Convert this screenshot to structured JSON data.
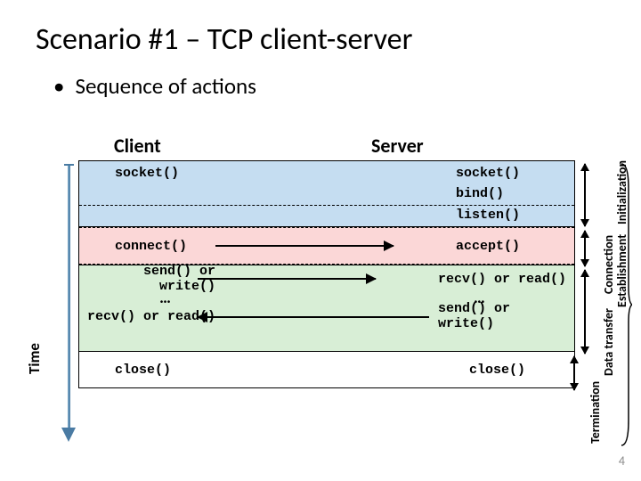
{
  "title": "Scenario #1 – TCP client-server",
  "subtitle_bullet": "•",
  "subtitle": "Sequence of actions",
  "headers": {
    "client": "Client",
    "server": "Server"
  },
  "phases": {
    "init": {
      "client": [
        "socket()"
      ],
      "server": [
        "socket()",
        "bind()",
        "listen()"
      ],
      "label": "Initialization"
    },
    "conn": {
      "client": "connect()",
      "server": "accept()",
      "label1": "Connection",
      "label2": "Establishment"
    },
    "data": {
      "client": [
        "send() or write()",
        "…",
        "recv() or read()"
      ],
      "server": [
        "recv() or read()",
        "…",
        "send() or write()"
      ],
      "label": "Data transfer"
    },
    "term": {
      "client": "close()",
      "server": "close()",
      "label": "Termination"
    }
  },
  "time_label": "Time",
  "page_number": "4"
}
